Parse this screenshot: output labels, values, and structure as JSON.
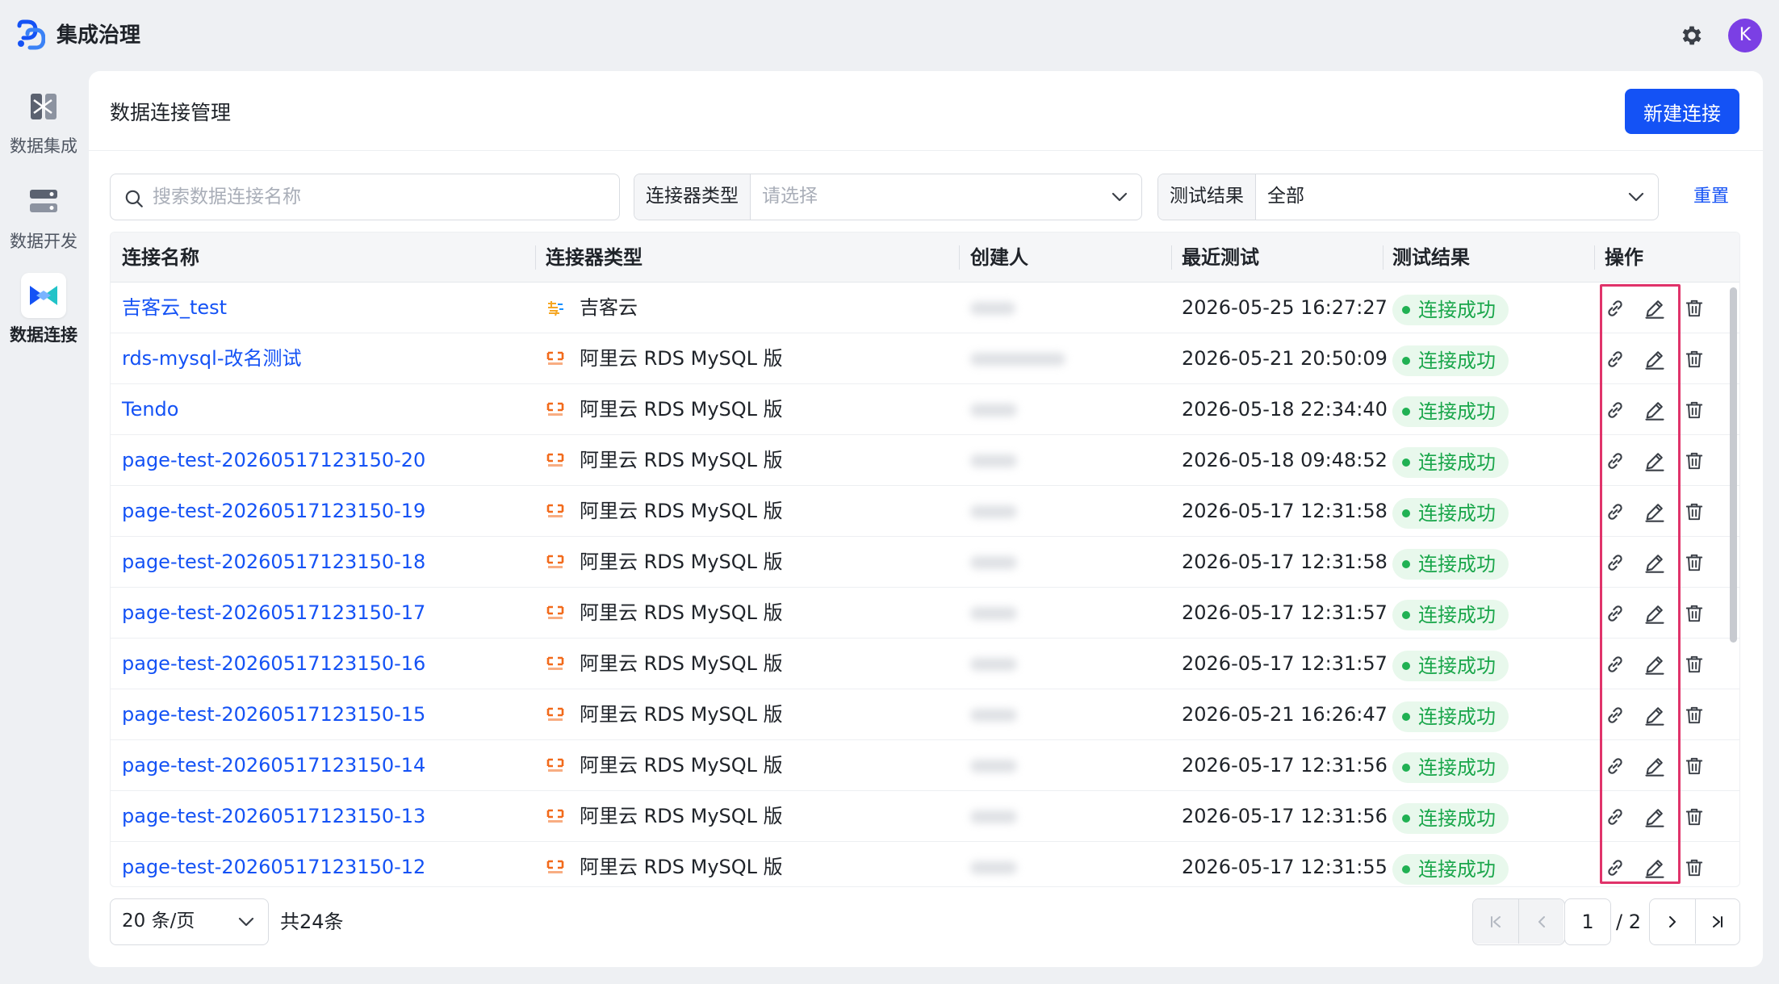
{
  "app": {
    "title": "集成治理",
    "avatar_letter": "K",
    "accent_color": "#1452f5"
  },
  "nav": {
    "items": [
      {
        "label": "数据集成",
        "icon": "data-integration-icon",
        "active": false
      },
      {
        "label": "数据开发",
        "icon": "data-development-icon",
        "active": false
      },
      {
        "label": "数据连接",
        "icon": "data-connection-icon",
        "active": true
      }
    ]
  },
  "page": {
    "title": "数据连接管理",
    "new_button": "新建连接"
  },
  "filters": {
    "search_placeholder": "搜索数据连接名称",
    "connector_type_label": "连接器类型",
    "connector_type_placeholder": "请选择",
    "test_result_label": "测试结果",
    "test_result_value": "全部",
    "reset": "重置"
  },
  "table": {
    "columns": [
      "连接名称",
      "连接器类型",
      "创建人",
      "最近测试",
      "测试结果",
      "操作"
    ],
    "rows": [
      {
        "name": "吉客云_test",
        "type": "吉客云",
        "type_icon": "jikeyun-icon",
        "time": "2026-05-25 16:27:27",
        "result": "连接成功"
      },
      {
        "name": "rds-mysql-改名测试",
        "type": "阿里云 RDS MySQL 版",
        "type_icon": "aliyun-rds-icon",
        "time": "2026-05-21 20:50:09",
        "result": "连接成功"
      },
      {
        "name": "Tendo",
        "type": "阿里云 RDS MySQL 版",
        "type_icon": "aliyun-rds-icon",
        "time": "2026-05-18 22:34:40",
        "result": "连接成功"
      },
      {
        "name": "page-test-20260517123150-20",
        "type": "阿里云 RDS MySQL 版",
        "type_icon": "aliyun-rds-icon",
        "time": "2026-05-18 09:48:52",
        "result": "连接成功"
      },
      {
        "name": "page-test-20260517123150-19",
        "type": "阿里云 RDS MySQL 版",
        "type_icon": "aliyun-rds-icon",
        "time": "2026-05-17 12:31:58",
        "result": "连接成功"
      },
      {
        "name": "page-test-20260517123150-18",
        "type": "阿里云 RDS MySQL 版",
        "type_icon": "aliyun-rds-icon",
        "time": "2026-05-17 12:31:58",
        "result": "连接成功"
      },
      {
        "name": "page-test-20260517123150-17",
        "type": "阿里云 RDS MySQL 版",
        "type_icon": "aliyun-rds-icon",
        "time": "2026-05-17 12:31:57",
        "result": "连接成功"
      },
      {
        "name": "page-test-20260517123150-16",
        "type": "阿里云 RDS MySQL 版",
        "type_icon": "aliyun-rds-icon",
        "time": "2026-05-17 12:31:57",
        "result": "连接成功"
      },
      {
        "name": "page-test-20260517123150-15",
        "type": "阿里云 RDS MySQL 版",
        "type_icon": "aliyun-rds-icon",
        "time": "2026-05-21 16:26:47",
        "result": "连接成功"
      },
      {
        "name": "page-test-20260517123150-14",
        "type": "阿里云 RDS MySQL 版",
        "type_icon": "aliyun-rds-icon",
        "time": "2026-05-17 12:31:56",
        "result": "连接成功"
      },
      {
        "name": "page-test-20260517123150-13",
        "type": "阿里云 RDS MySQL 版",
        "type_icon": "aliyun-rds-icon",
        "time": "2026-05-17 12:31:56",
        "result": "连接成功"
      },
      {
        "name": "page-test-20260517123150-12",
        "type": "阿里云 RDS MySQL 版",
        "type_icon": "aliyun-rds-icon",
        "time": "2026-05-17 12:31:55",
        "result": "连接成功"
      }
    ],
    "success_color": "#1aa64b"
  },
  "pagination": {
    "page_size": "20 条/页",
    "total": "共24条",
    "current_page": "1",
    "total_pages": "/ 2"
  }
}
